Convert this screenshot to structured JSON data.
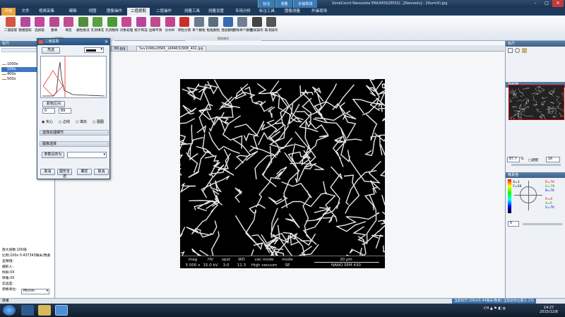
{
  "app": {
    "title": "ZoneCount Nanoxiete ERA3000/ZEISS/...[Nanoedu] - 20um(4).jpg",
    "context_tabs": [
      "标注",
      "测量",
      "外操现场"
    ],
    "window_controls": [
      "–",
      "□",
      "✕"
    ]
  },
  "menu": [
    "开始",
    "文件",
    "视频采集",
    "编辑",
    "视图",
    "图像操作",
    "二值提取",
    "二值操作",
    "测量工具",
    "测量设置",
    "专用分析",
    "标注工具",
    "图像测量",
    "外操现场"
  ],
  "menu_active": 6,
  "toolbar": [
    {
      "label": "二值提取",
      "icon": "extract-icon",
      "color": "#d4543f"
    },
    {
      "label": "锁相提取",
      "icon": "lock-extract-icon",
      "color": "#b24aa0"
    },
    {
      "label": "选择提",
      "icon": "select-icon",
      "color": "#c3469c"
    },
    {
      "label": "重填",
      "icon": "refill-icon",
      "color": "#b84a94"
    },
    {
      "label": "填充",
      "icon": "fill-icon",
      "color": "#c24d8f"
    },
    {
      "label": "删粒剔法",
      "icon": "delete-particle-icon",
      "color": "#4f8f3a"
    },
    {
      "label": "孔洞填充",
      "icon": "hole-fill-icon",
      "color": "#5aa13e"
    },
    {
      "label": "孔洞剔除",
      "icon": "hole-remove-icon",
      "color": "#4a9a36"
    },
    {
      "label": "对象处理",
      "icon": "object-icon",
      "color": "#c84694"
    },
    {
      "label": "统计筛选",
      "icon": "filter-icon",
      "color": "#b8459c"
    },
    {
      "label": "边缘平滑",
      "icon": "smooth-icon",
      "color": "#c04a8e"
    },
    {
      "label": "分水岭",
      "icon": "watershed-icon",
      "color": "#c3458f"
    },
    {
      "label": "单粒分割",
      "icon": "single-split-icon",
      "color": "#c9302c"
    },
    {
      "label": "单个删粒",
      "icon": "single-delete-icon",
      "color": "#6a7b8e"
    },
    {
      "label": "框框删粒",
      "icon": "box-delete-icon",
      "color": "#5b6c7f"
    },
    {
      "label": "连加删粒",
      "icon": "add-delete-icon",
      "color": "#3569b3"
    },
    {
      "label": "擦除单个删粒",
      "icon": "erase-icon",
      "color": "#6f7f91"
    },
    {
      "label": "连续操作",
      "icon": "continuous-icon",
      "color": "#444"
    },
    {
      "label": "取消操作",
      "icon": "cancel-op-icon",
      "color": "#555"
    }
  ],
  "toolbar_groups": [
    "二值提取",
    "",
    "",
    "",
    "提取操作"
  ],
  "left": {
    "header": "标尺",
    "mags": [
      {
        "label": "1000x",
        "color": "#e08a00"
      },
      {
        "label": "100x",
        "color": "#1560c8"
      },
      {
        "label": "400x",
        "color": "#d86a1a"
      },
      {
        "label": "500x",
        "color": "#c57416"
      }
    ],
    "selected": 1,
    "info": [
      "放大倍数:100倍",
      "比例:100x 0.437343微米/像素",
      "显微镜:",
      "摄影人:",
      "倾斜:0X",
      "转角:0X",
      "实验室:",
      "转换单位:"
    ],
    "unit": "Micron"
  },
  "doc_tabs": [
    "30l.jpg",
    "5xv1096x2890l_1484632908_402.jpg"
  ],
  "dialog": {
    "title": "二值提取",
    "mode_btn": "亮选",
    "range_label": "颜色区间",
    "min": "0",
    "max": "89",
    "modes": [
      "实心",
      "边线",
      "填充",
      "图图"
    ],
    "sections": [
      "选择处理细节",
      "图像选择"
    ],
    "param_btn": "参数另存为",
    "buttons": [
      "取消",
      "图形全选",
      "确定",
      "取消"
    ]
  },
  "sem": {
    "labels": [
      "mag",
      "HV",
      "spot",
      "WD",
      "vac mode",
      "mode"
    ],
    "values": [
      "5 000 x",
      "15.0 kV",
      "3.0",
      "12.3 mm",
      "High vacuum",
      "SE"
    ],
    "scale": "20 µm",
    "brand": "NANO SEM 430"
  },
  "right": {
    "header": "标尺",
    "nav_header": "导航器",
    "zoom": "87.7",
    "zoom_unit": "%",
    "fit_label": "□适配",
    "num": "16",
    "color_header": "像素值",
    "readouts": [
      "X=1",
      "Y=26",
      "R=76",
      "G=76",
      "B=76",
      "H=0",
      "S=0",
      "V=76"
    ],
    "slider_val": "0"
  },
  "status": {
    "left": "就绪",
    "right": "当前标尺:100x(0.44微米/像素) 当前鼠标位置(1.23)"
  },
  "clock": {
    "time": "14:27",
    "date": "2015/12/8"
  }
}
